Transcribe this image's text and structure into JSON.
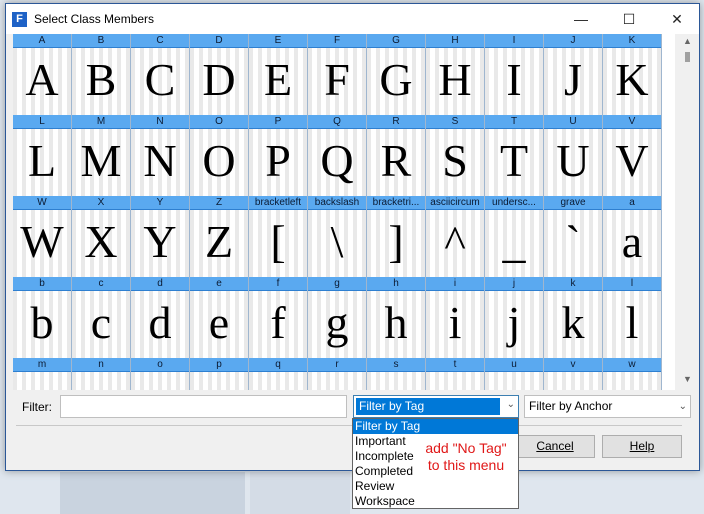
{
  "window": {
    "title": "Select Class Members",
    "app_icon": "F",
    "minimize_icon": "minimize-icon",
    "maximize_icon": "maximize-icon",
    "close_icon": "close-icon"
  },
  "glyph_grid": {
    "cells": [
      {
        "name": "A",
        "glyph": "A"
      },
      {
        "name": "B",
        "glyph": "B"
      },
      {
        "name": "C",
        "glyph": "C"
      },
      {
        "name": "D",
        "glyph": "D"
      },
      {
        "name": "E",
        "glyph": "E"
      },
      {
        "name": "F",
        "glyph": "F"
      },
      {
        "name": "G",
        "glyph": "G"
      },
      {
        "name": "H",
        "glyph": "H"
      },
      {
        "name": "I",
        "glyph": "I"
      },
      {
        "name": "J",
        "glyph": "J"
      },
      {
        "name": "K",
        "glyph": "K"
      },
      {
        "name": "L",
        "glyph": "L"
      },
      {
        "name": "M",
        "glyph": "M"
      },
      {
        "name": "N",
        "glyph": "N"
      },
      {
        "name": "O",
        "glyph": "O"
      },
      {
        "name": "P",
        "glyph": "P"
      },
      {
        "name": "Q",
        "glyph": "Q"
      },
      {
        "name": "R",
        "glyph": "R"
      },
      {
        "name": "S",
        "glyph": "S"
      },
      {
        "name": "T",
        "glyph": "T"
      },
      {
        "name": "U",
        "glyph": "U"
      },
      {
        "name": "V",
        "glyph": "V"
      },
      {
        "name": "W",
        "glyph": "W"
      },
      {
        "name": "X",
        "glyph": "X"
      },
      {
        "name": "Y",
        "glyph": "Y"
      },
      {
        "name": "Z",
        "glyph": "Z"
      },
      {
        "name": "bracketleft",
        "glyph": "["
      },
      {
        "name": "backslash",
        "glyph": "\\"
      },
      {
        "name": "bracketri...",
        "glyph": "]"
      },
      {
        "name": "asciicircum",
        "glyph": "^"
      },
      {
        "name": "undersc...",
        "glyph": "_"
      },
      {
        "name": "grave",
        "glyph": "`"
      },
      {
        "name": "a",
        "glyph": "a"
      },
      {
        "name": "b",
        "glyph": "b"
      },
      {
        "name": "c",
        "glyph": "c"
      },
      {
        "name": "d",
        "glyph": "d"
      },
      {
        "name": "e",
        "glyph": "e"
      },
      {
        "name": "f",
        "glyph": "f"
      },
      {
        "name": "g",
        "glyph": "g"
      },
      {
        "name": "h",
        "glyph": "h"
      },
      {
        "name": "i",
        "glyph": "i"
      },
      {
        "name": "j",
        "glyph": "j"
      },
      {
        "name": "k",
        "glyph": "k"
      },
      {
        "name": "l",
        "glyph": "l"
      },
      {
        "name": "m",
        "glyph": ""
      },
      {
        "name": "n",
        "glyph": ""
      },
      {
        "name": "o",
        "glyph": ""
      },
      {
        "name": "p",
        "glyph": ""
      },
      {
        "name": "q",
        "glyph": ""
      },
      {
        "name": "r",
        "glyph": ""
      },
      {
        "name": "s",
        "glyph": ""
      },
      {
        "name": "t",
        "glyph": ""
      },
      {
        "name": "u",
        "glyph": ""
      },
      {
        "name": "v",
        "glyph": ""
      },
      {
        "name": "w",
        "glyph": ""
      }
    ]
  },
  "filter": {
    "label": "Filter:",
    "value": "",
    "tag_select": "Filter by Tag",
    "anchor_select": "Filter by Anchor"
  },
  "tag_dropdown": {
    "options": [
      "Filter by Tag",
      "Important",
      "Incomplete",
      "Completed",
      "Review",
      "Workspace"
    ],
    "selected_index": 0
  },
  "buttons": {
    "cancel": "Cancel",
    "help": "Help"
  },
  "annotation": {
    "line1": "add \"No Tag\"",
    "line2": "to this menu"
  },
  "colors": {
    "header_blue": "#5aa9f0",
    "selection": "#0078d7",
    "annotation_red": "#e01818"
  }
}
